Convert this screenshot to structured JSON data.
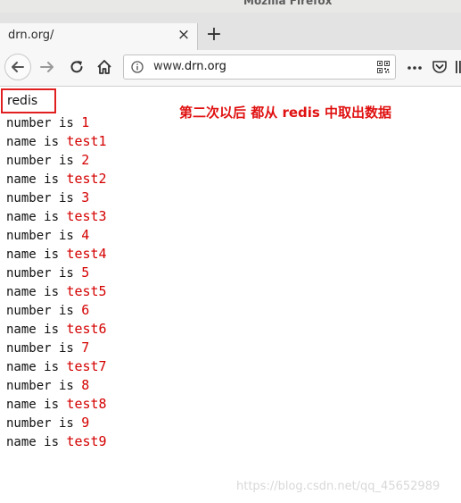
{
  "window": {
    "title": "Mozilla Firefox"
  },
  "tab": {
    "title": "drn.org/",
    "close_glyph": "×",
    "new_tab_glyph": "+"
  },
  "urlbar": {
    "prefix": "www.",
    "host": "drn.org"
  },
  "page": {
    "redis_label": "redis",
    "annotation": "第二次以后 都从 redis 中取出数据",
    "rows": [
      {
        "label": "number is ",
        "value": "1"
      },
      {
        "label": "name is ",
        "value": "test1"
      },
      {
        "label": "number is ",
        "value": "2"
      },
      {
        "label": "name is ",
        "value": "test2"
      },
      {
        "label": "number is ",
        "value": "3"
      },
      {
        "label": "name is ",
        "value": "test3"
      },
      {
        "label": "number is ",
        "value": "4"
      },
      {
        "label": "name is ",
        "value": "test4"
      },
      {
        "label": "number is ",
        "value": "5"
      },
      {
        "label": "name is ",
        "value": "test5"
      },
      {
        "label": "number is ",
        "value": "6"
      },
      {
        "label": "name is ",
        "value": "test6"
      },
      {
        "label": "number is ",
        "value": "7"
      },
      {
        "label": "name is ",
        "value": "test7"
      },
      {
        "label": "number is ",
        "value": "8"
      },
      {
        "label": "name is ",
        "value": "test8"
      },
      {
        "label": "number is ",
        "value": "9"
      },
      {
        "label": "name is ",
        "value": "test9"
      }
    ],
    "watermark": "https://blog.csdn.net/qq_45652989"
  },
  "colors": {
    "accent_red": "#d40000",
    "annotation_red": "#e01010",
    "highlight_border": "#e02020"
  },
  "icons": [
    "back-arrow-icon",
    "forward-arrow-icon",
    "reload-icon",
    "home-icon",
    "info-icon",
    "qr-code-icon",
    "more-dots-icon",
    "pocket-icon",
    "overflow-icon"
  ]
}
